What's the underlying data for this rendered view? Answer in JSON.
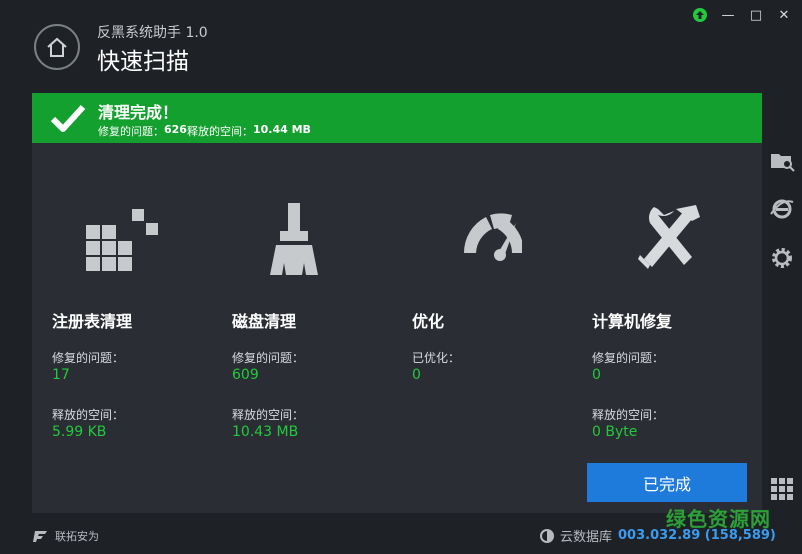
{
  "app": {
    "title": "反黑系统助手 1.0",
    "page_title": "快速扫描"
  },
  "window_controls": {
    "upgrade": "upgrade-icon",
    "minimize": "—",
    "maximize": "□",
    "close": "✕"
  },
  "banner": {
    "title": "清理完成！",
    "issues_label": "修复的问题：",
    "issues_value": "626",
    "space_label": "释放的空间：",
    "space_value": "10.44 MB",
    "color": "#14a02e"
  },
  "columns": [
    {
      "title": "注册表清理",
      "label1": "修复的问题：",
      "value1": "17",
      "label2": "释放的空间：",
      "value2": "5.99 KB",
      "icon": "registry-blocks-icon"
    },
    {
      "title": "磁盘清理",
      "label1": "修复的问题：",
      "value1": "609",
      "label2": "释放的空间：",
      "value2": "10.43 MB",
      "icon": "broom-icon"
    },
    {
      "title": "优化",
      "label1": "已优化：",
      "value1": "0",
      "icon": "speedometer-icon"
    },
    {
      "title": "计算机修复",
      "label1": "修复的问题：",
      "value1": "0",
      "label2": "释放的空间：",
      "value2": "0 Byte",
      "icon": "wrench-hammer-icon"
    }
  ],
  "done_button": "已完成",
  "sidebar": [
    "folder-search-icon",
    "ie-settings-icon",
    "gear-icon",
    "apps-grid-icon"
  ],
  "footer": {
    "brand": "联拓安为",
    "db_label": "云数据库",
    "db_version": "003.032.89 (158,589)"
  },
  "watermark": "绿色资源网",
  "colors": {
    "accent_green": "#22c93c",
    "button_blue": "#1e7bdc",
    "background": "#1e2227",
    "panel": "#2a2e34"
  }
}
